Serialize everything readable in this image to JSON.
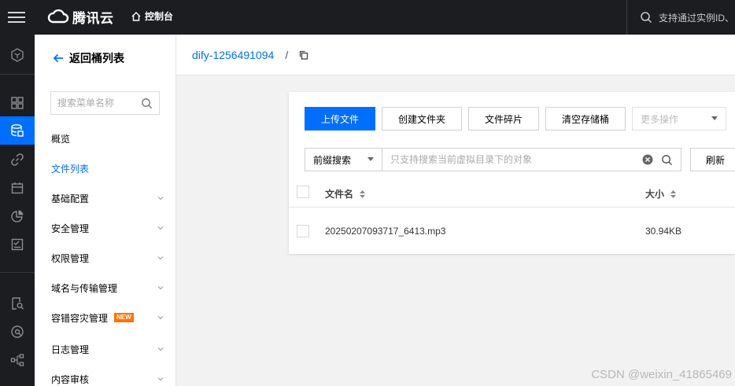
{
  "topbar": {
    "logo_text": "腾讯云",
    "console_label": "控制台",
    "search_placeholder": "支持通过实例ID、"
  },
  "rail": {
    "icons": [
      "cube-icon",
      "dashboard-icon",
      "storage-icon",
      "link-icon",
      "calendar-icon",
      "chart-pie-icon",
      "checklist-icon",
      "search-doc-icon",
      "shield-icon",
      "network-icon"
    ],
    "active": "storage-icon"
  },
  "nav": {
    "back_label": "返回桶列表",
    "search_placeholder": "搜索菜单名称",
    "items": [
      {
        "label": "概览",
        "active": false
      },
      {
        "label": "文件列表",
        "active": true
      },
      {
        "label": "基础配置",
        "active": false
      },
      {
        "label": "安全管理",
        "active": false
      },
      {
        "label": "权限管理",
        "active": false
      },
      {
        "label": "域名与传输管理",
        "active": false
      },
      {
        "label": "容错容灾管理",
        "active": false,
        "badge": "NEW"
      },
      {
        "label": "日志管理",
        "active": false
      },
      {
        "label": "内容审核",
        "active": false
      }
    ]
  },
  "breadcrumb": {
    "bucket": "dify-1256491094",
    "separator": "/"
  },
  "toolbar": {
    "upload": "上传文件",
    "create_folder": "创建文件夹",
    "fragments": "文件碎片",
    "empty_bucket": "清空存储桶",
    "more": "更多操作",
    "prefix_select": "前缀搜索",
    "search_placeholder": "只支持搜索当前虚拟目录下的对象",
    "refresh": "刷新"
  },
  "table": {
    "columns": [
      "文件名",
      "大小"
    ],
    "rows": [
      {
        "name": "20250207093717_6413.mp3",
        "size": "30.94KB"
      }
    ]
  },
  "watermark": "CSDN @weixin_41865469",
  "colors": {
    "accent": "#006eff",
    "topbar_bg": "#1b1d20",
    "new_badge": "#ff7200"
  }
}
